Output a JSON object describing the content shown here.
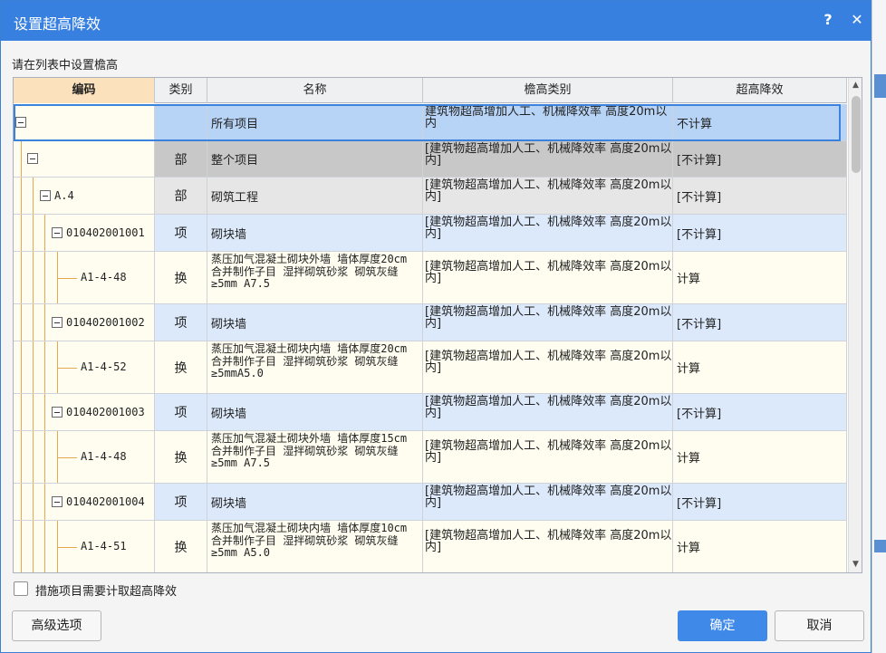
{
  "dialog": {
    "title": "设置超高降效",
    "help_label": "?",
    "close_label": "✕",
    "prompt": "请在列表中设置檐高"
  },
  "columns": [
    "编码",
    "类别",
    "名称",
    "檐高类别",
    "超高降效"
  ],
  "rows": [
    {
      "code": "",
      "type": "",
      "name": "所有项目",
      "category": "建筑物超高增加人工、机械降效率 高度20m以内",
      "effect": "不计算"
    },
    {
      "code": "",
      "type": "部",
      "name": "整个项目",
      "category": "[建筑物超高增加人工、机械降效率 高度20m以内]",
      "effect": "[不计算]"
    },
    {
      "code": "A.4",
      "type": "部",
      "name": "砌筑工程",
      "category": "[建筑物超高增加人工、机械降效率 高度20m以内]",
      "effect": "[不计算]"
    },
    {
      "code": "010402001001",
      "type": "项",
      "name": "砌块墙",
      "category": "[建筑物超高增加人工、机械降效率 高度20m以内]",
      "effect": "[不计算]"
    },
    {
      "code": "A1-4-48",
      "type": "换",
      "name": "蒸压加气混凝土砌块外墙 墙体厚度20cm  合并制作子目 湿拌砌筑砂浆 砌筑灰缝≥5mm A7.5",
      "category": "[建筑物超高增加人工、机械降效率 高度20m以内]",
      "effect": "计算"
    },
    {
      "code": "010402001002",
      "type": "项",
      "name": "砌块墙",
      "category": "[建筑物超高增加人工、机械降效率 高度20m以内]",
      "effect": "[不计算]"
    },
    {
      "code": "A1-4-52",
      "type": "换",
      "name": "蒸压加气混凝土砌块内墙 墙体厚度20cm  合并制作子目 湿拌砌筑砂浆 砌筑灰缝≥5mmA5.0",
      "category": "[建筑物超高增加人工、机械降效率 高度20m以内]",
      "effect": "计算"
    },
    {
      "code": "010402001003",
      "type": "项",
      "name": "砌块墙",
      "category": "[建筑物超高增加人工、机械降效率 高度20m以内]",
      "effect": "[不计算]"
    },
    {
      "code": "A1-4-48",
      "type": "换",
      "name": "蒸压加气混凝土砌块外墙 墙体厚度15cm  合并制作子目 湿拌砌筑砂浆 砌筑灰缝≥5mm A7.5",
      "category": "[建筑物超高增加人工、机械降效率 高度20m以内]",
      "effect": "计算"
    },
    {
      "code": "010402001004",
      "type": "项",
      "name": "砌块墙",
      "category": "[建筑物超高增加人工、机械降效率 高度20m以内]",
      "effect": "[不计算]"
    },
    {
      "code": "A1-4-51",
      "type": "换",
      "name": "蒸压加气混凝土砌块内墙 墙体厚度10cm  合并制作子目 湿拌砌筑砂浆 砌筑灰缝≥5mm A5.0",
      "category": "[建筑物超高增加人工、机械降效率 高度20m以内]",
      "effect": "计算"
    }
  ],
  "checkbox": {
    "label": "措施项目需要计取超高降效",
    "checked": false
  },
  "buttons": {
    "advanced": "高级选项",
    "ok": "确定",
    "cancel": "取消"
  },
  "colors": {
    "title_bar": "#3880e0",
    "selected_row": "#b7d4f7",
    "project_row": "#c8c8c8",
    "section_row": "#e6e6e6",
    "item_row": "#dce9fb",
    "sub_row": "#fffdf0",
    "header_selected": "#fbe2bc",
    "ok_button": "#3f8ae8"
  }
}
